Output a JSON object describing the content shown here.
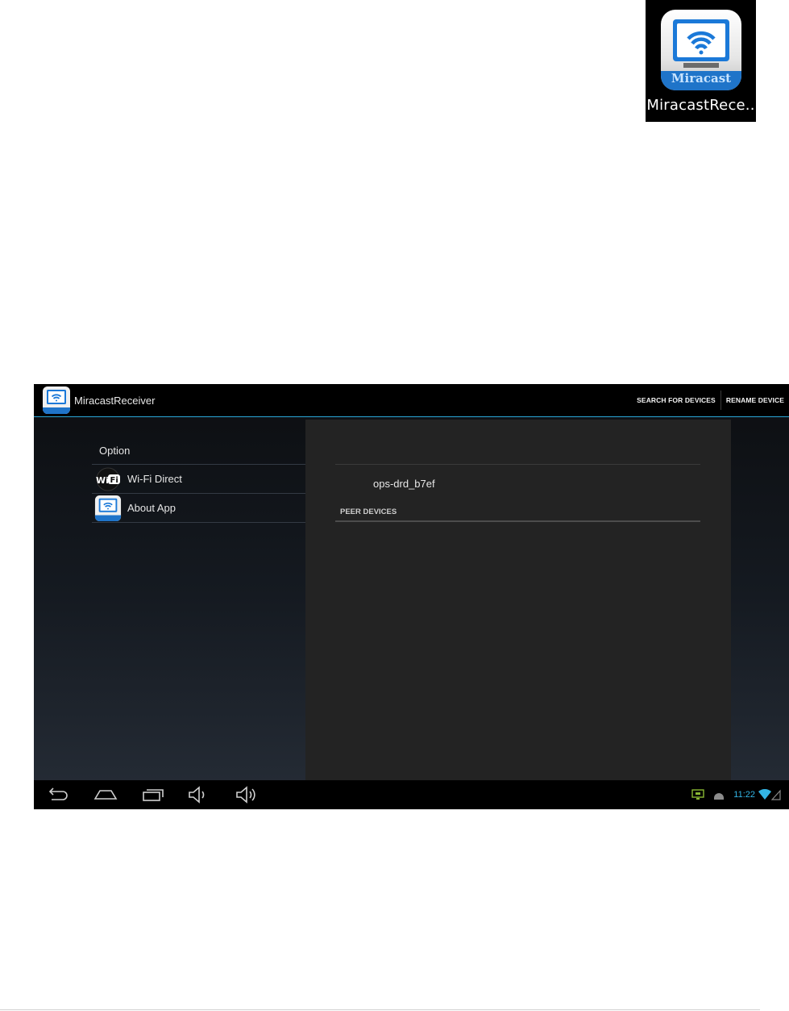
{
  "launcher": {
    "label": "MiracastRece..",
    "icon": "miracast-icon",
    "icon_text": "Miracast"
  },
  "app": {
    "title": "MiracastReceiver",
    "actions": {
      "search": "SEARCH FOR DEVICES",
      "rename": "RENAME DEVICE"
    }
  },
  "options": {
    "header": "Option",
    "items": [
      {
        "label": "Wi-Fi Direct",
        "icon": "wifi-direct-icon",
        "icon_text": "WiFi"
      },
      {
        "label": "About App",
        "icon": "miracast-icon"
      }
    ]
  },
  "detail": {
    "device_name": "ops-drd_b7ef",
    "peer_header": "PEER DEVICES"
  },
  "system_bar": {
    "nav": [
      "back-icon",
      "home-icon",
      "recents-icon",
      "volume-down-icon",
      "volume-up-icon"
    ],
    "clock": "11:22",
    "status_icons": [
      "screen-mirror-icon",
      "android-debug-icon",
      "wifi-signal-icon",
      "cell-signal-icon"
    ]
  },
  "colors": {
    "accent": "#33b5e5",
    "status_green": "#8ab833"
  }
}
